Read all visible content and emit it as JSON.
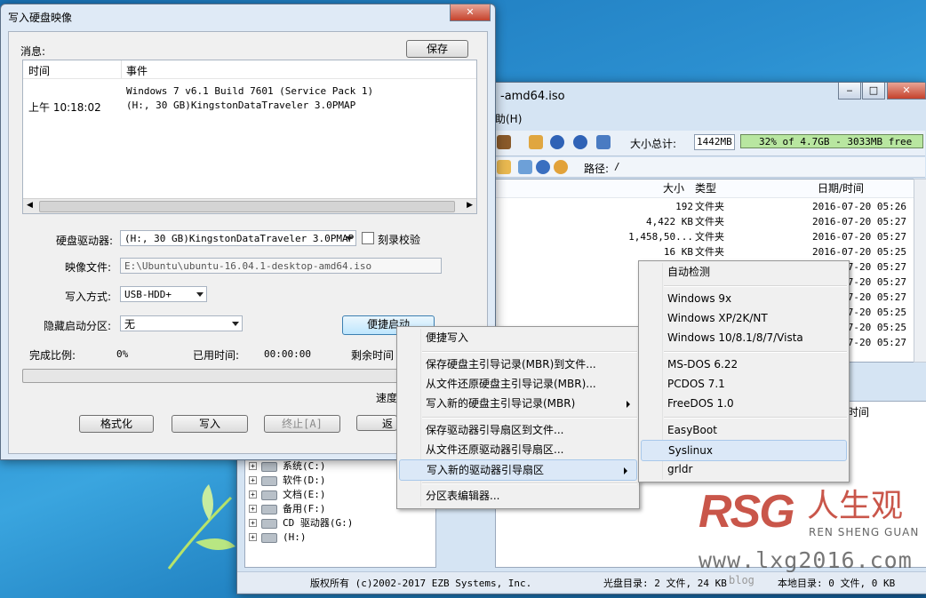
{
  "dialog": {
    "title": "写入硬盘映像",
    "messages_label": "消息:",
    "save_button": "保存",
    "log_columns": [
      "时间",
      "事件"
    ],
    "log_entries": [
      {
        "time": "",
        "event": "Windows 7 v6.1 Build 7601 (Service Pack 1)"
      },
      {
        "time": "上午 10:18:02",
        "event": "(H:, 30 GB)KingstonDataTraveler 3.0PMAP"
      }
    ],
    "drive_label": "硬盘驱动器:",
    "drive_value": "(H:, 30 GB)KingstonDataTraveler 3.0PMAP",
    "verify_label": "刻录校验",
    "image_label": "映像文件:",
    "image_value": "E:\\Ubuntu\\ubuntu-16.04.1-desktop-amd64.iso",
    "write_mode_label": "写入方式:",
    "write_mode_value": "USB-HDD+",
    "hide_part_label": "隐藏启动分区:",
    "hide_part_value": "无",
    "quick_start_button": "便捷启动",
    "progress_label": "完成比例:",
    "progress_value": "0%",
    "elapsed_label": "已用时间:",
    "elapsed_value": "00:00:00",
    "remaining_label": "剩余时间",
    "speed_label": "速度",
    "format_button": "格式化",
    "write_button": "写入",
    "abort_button": "终止[A]",
    "return_button": "返"
  },
  "bg_window": {
    "title_fragment": "-amd64.iso",
    "menu_fragment": "助(H)",
    "total_size_label": "大小总计:",
    "total_size_value": "1442MB",
    "capacity_text": "32% of 4.7GB - 3033MB free",
    "path_label": "路径:",
    "path_value": "/",
    "columns": [
      "大小",
      "类型",
      "日期/时间"
    ],
    "files": [
      {
        "size": "192",
        "type": "文件夹",
        "date": "2016-07-20 05:26"
      },
      {
        "size": "4,422 KB",
        "type": "文件夹",
        "date": "2016-07-20 05:27"
      },
      {
        "size": "1,458,50...",
        "type": "文件夹",
        "date": "2016-07-20 05:27"
      },
      {
        "size": "16 KB",
        "type": "文件夹",
        "date": "2016-07-20 05:25"
      },
      {
        "size": "",
        "type": "",
        "date": "07-20 05:27"
      },
      {
        "size": "",
        "type": "",
        "date": "07-20 05:27"
      },
      {
        "size": "",
        "type": "",
        "date": "07-20 05:27"
      },
      {
        "size": "",
        "type": "",
        "date": "07-20 05:25"
      },
      {
        "size": "",
        "type": "",
        "date": "07-20 05:25"
      },
      {
        "size": "",
        "type": "",
        "date": "07-20 05:27"
      }
    ],
    "lower_col_date": "时间",
    "tree_items": [
      "系统(C:)",
      "软件(D:)",
      "文档(E:)",
      "备用(F:)",
      "CD 驱动器(G:)",
      "(H:)"
    ],
    "status_copyright": "版权所有 (c)2002-2017 EZB Systems, Inc.",
    "status_disc": "光盘目录: 2 文件, 24 KB",
    "status_local": "本地目录: 0 文件, 0 KB"
  },
  "context_menu": {
    "items": [
      "便捷写入",
      "保存硬盘主引导记录(MBR)到文件...",
      "从文件还原硬盘主引导记录(MBR)...",
      "写入新的硬盘主引导记录(MBR)",
      "保存驱动器引导扇区到文件...",
      "从文件还原驱动器引导扇区...",
      "写入新的驱动器引导扇区",
      "分区表编辑器..."
    ]
  },
  "submenu": {
    "items": [
      "自动检测",
      "Windows 9x",
      "Windows XP/2K/NT",
      "Windows 10/8.1/8/7/Vista",
      "MS-DOS 6.22",
      "PCDOS 7.1",
      "FreeDOS 1.0",
      "EasyBoot",
      "Syslinux",
      "grldr"
    ]
  },
  "watermark": {
    "logo_letters": "RSG",
    "logo_cn": "人生观",
    "logo_pinyin": "REN SHENG GUAN",
    "url": "www.lxg2016.com",
    "blog_fragment": "blog"
  },
  "colors": {
    "desktop_blue": "#2b8fd0",
    "menu_highlight": "#d9e8f7",
    "capacity_green": "#b8e6a0",
    "logo_red": "#c0392b"
  }
}
